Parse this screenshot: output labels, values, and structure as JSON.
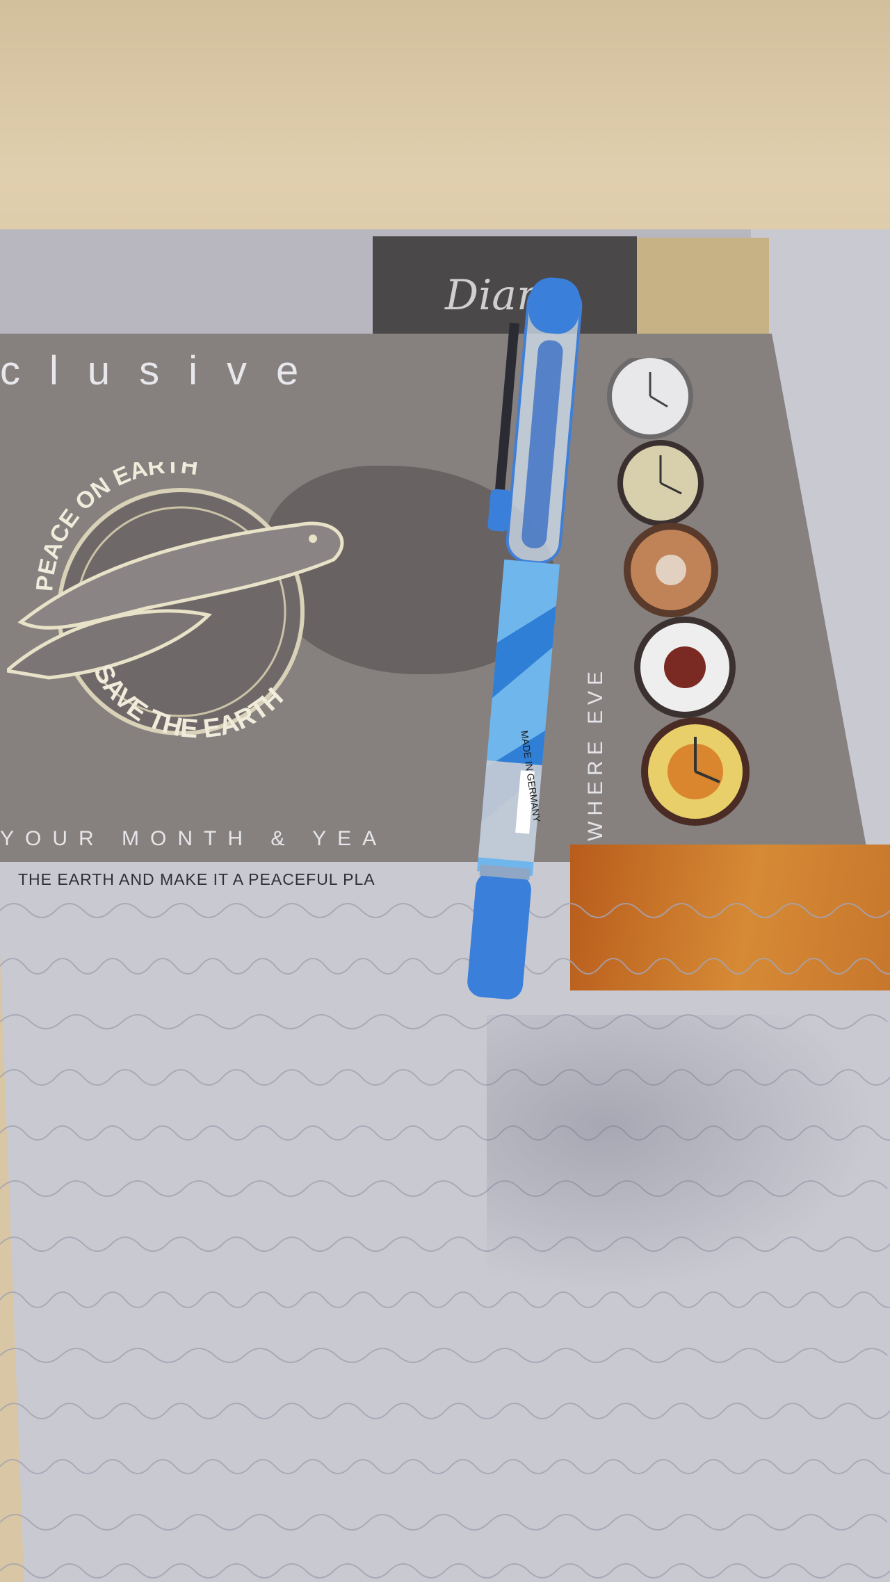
{
  "scene": {
    "description_free": true,
    "colors": {
      "table": "#d9c6a4",
      "cover_grey": "#86807f",
      "paper": "#c9c9d2",
      "pen_blue": "#3a7fd9",
      "orange_block": "#c9742a"
    }
  },
  "diary_cover": {
    "brand_text": "Diar",
    "headline": "clusive",
    "emblem_top": "PEACE ON EARTH",
    "emblem_bottom": "SAVE THE EARTH",
    "vertical_text": "WHERE EVE",
    "tagline_1": "YOUR MONTH & YEA",
    "tagline_2": "THE EARTH AND MAKE IT A PEACEFUL PLA"
  },
  "pen": {
    "label": "MADE IN GERMANY"
  },
  "icons": [
    "clock-face-icon",
    "clock-face-icon",
    "clock-face-icon",
    "clock-face-icon",
    "clock-face-icon",
    "dove-emblem-icon"
  ]
}
